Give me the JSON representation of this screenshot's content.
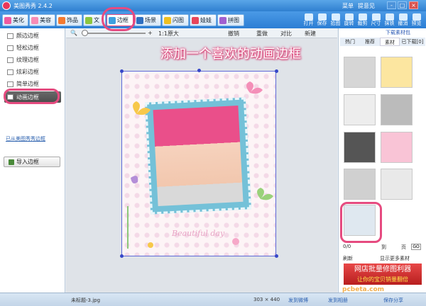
{
  "window": {
    "title": "美图秀秀 2.4.2",
    "menu": "菜单",
    "feedback": "提意见",
    "min": "-",
    "max": "□",
    "close": "×"
  },
  "tabs": [
    {
      "label": "美化",
      "color": "#f05aa0"
    },
    {
      "label": "美容",
      "color": "#f78cb5"
    },
    {
      "label": "饰品",
      "color": "#f47a30"
    },
    {
      "label": "文",
      "color": "#8cc63f"
    },
    {
      "label": "边框",
      "color": "#3da0e0"
    },
    {
      "label": "场景",
      "color": "#2f6fc0"
    },
    {
      "label": "闪图",
      "color": "#f0c020"
    },
    {
      "label": "娃娃",
      "color": "#e8455a"
    },
    {
      "label": "拼图",
      "color": "#a060d0"
    }
  ],
  "toolbar_right": [
    "打开",
    "保存",
    "拾图",
    "旋转",
    "裁剪",
    "尺寸",
    "抹铁",
    "撤消",
    "预览"
  ],
  "left_panel": {
    "items": [
      "颜边边框",
      "轻松边框",
      "纹理边框",
      "炫彩边框",
      "简单边框",
      "动画边框"
    ],
    "link": "已从美图秀秀边框",
    "import_btn": "导入边框"
  },
  "subbar": {
    "zoom_label": "1:1原大",
    "undo": "撤销",
    "redo": "重做",
    "compare": "对比",
    "new": "新建"
  },
  "canvas": {
    "caption": "Beautiful day"
  },
  "annotation": "添加一个喜欢的动画边框",
  "right_panel": {
    "download_link": "下载素材包",
    "tabs": [
      "热门",
      "推荐",
      "素材",
      "已下载[0]"
    ],
    "page": "0/0",
    "page_to": "到",
    "page_suffix": "页",
    "go": "GO",
    "refresh": "刷新",
    "browse": "显示更多素材"
  },
  "ad": {
    "line1": "网店批量修图利器",
    "line2": "让你的宝贝销量翻倍"
  },
  "statusbar": {
    "filename": "未标题-3.jpg",
    "dims": "303 × 440",
    "share1": "发到微博",
    "share2": "发到相册",
    "share3": "保存分享"
  },
  "watermark": "pcbeta.com"
}
